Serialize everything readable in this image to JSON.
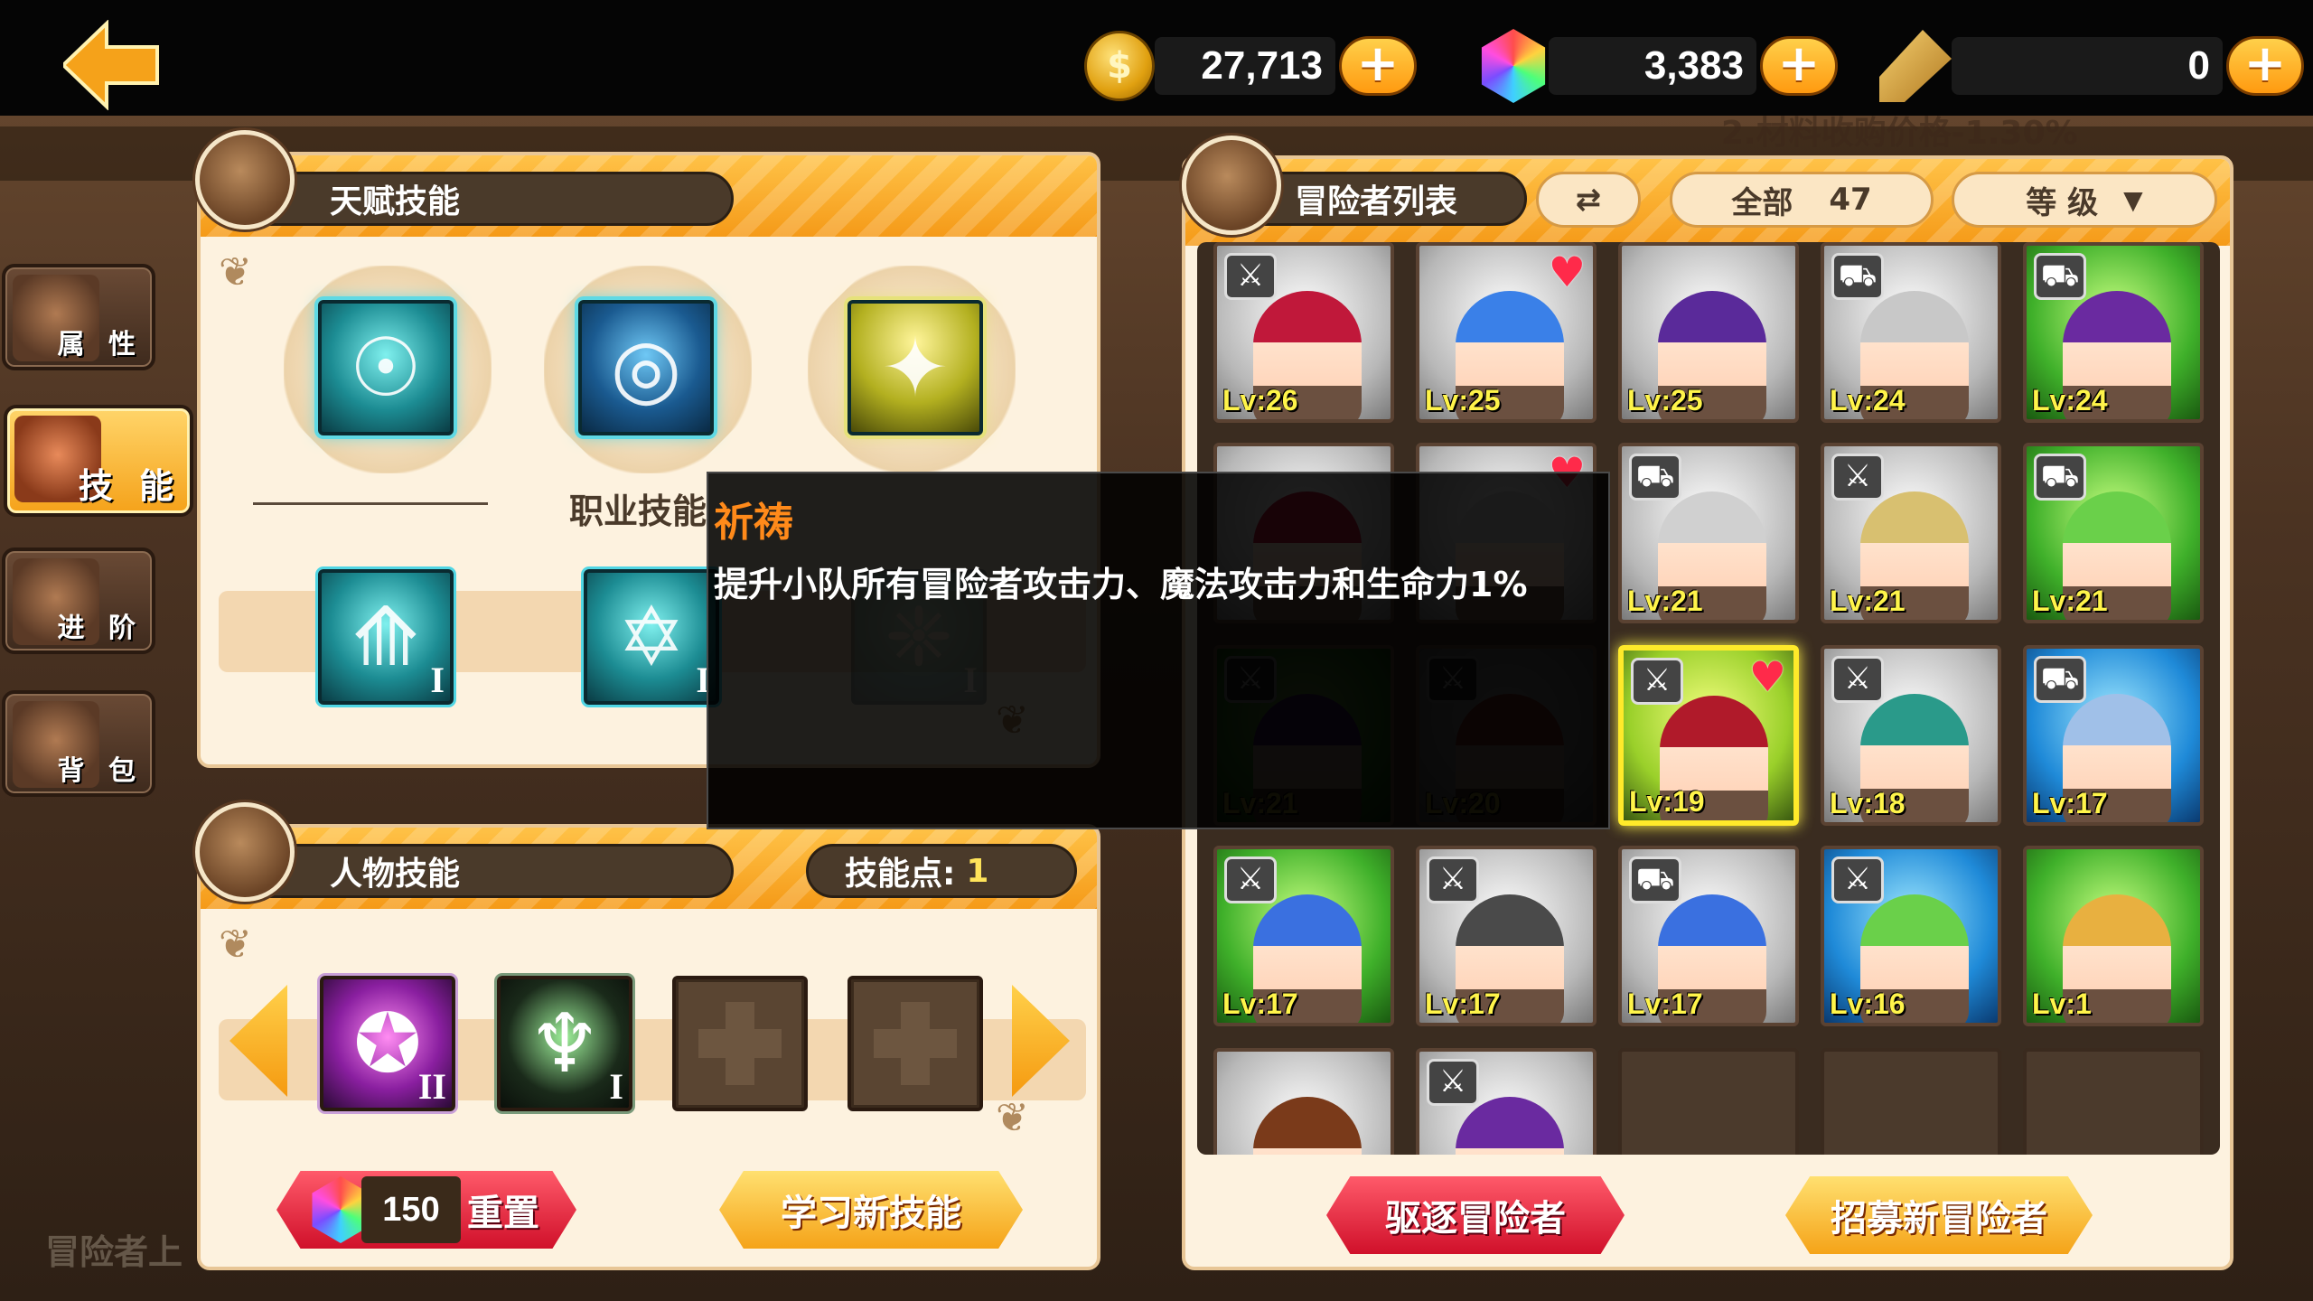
{
  "currencies": {
    "gold": "27,713",
    "gems": "3,383",
    "tickets": "0",
    "plus_label": "+"
  },
  "left_tabs": [
    {
      "label": "属 性",
      "icon": "knight-helmet-icon"
    },
    {
      "label": "技 能",
      "icon": "spellbook-icon"
    },
    {
      "label": "进 阶",
      "icon": "shield-gem-icon"
    },
    {
      "label": "背 包",
      "icon": "backpack-icon"
    }
  ],
  "talent_panel": {
    "title": "天赋技能",
    "job_skill_label": "职业技能"
  },
  "talent_skills": [
    {
      "icon": "brain-icon",
      "color": "teal"
    },
    {
      "icon": "hypnosis-book-icon",
      "color": "blue"
    },
    {
      "icon": "starlight-icon",
      "color": "gold"
    }
  ],
  "job_skills": [
    {
      "icon": "arrow-triangle-icon",
      "level": "I"
    },
    {
      "icon": "hexagram-flame-icon",
      "level": "I"
    },
    {
      "icon": "faded-skill-icon",
      "level": "I"
    }
  ],
  "character_panel": {
    "title": "人物技能",
    "skill_points_label": "技能点:",
    "skill_points": "1"
  },
  "character_skills": [
    {
      "icon": "dark-compass-icon",
      "level": "II",
      "type": "purple"
    },
    {
      "icon": "prayer-icon",
      "level": "I",
      "type": "dark"
    },
    {
      "icon": "add-slot-icon",
      "level": "",
      "type": "empty"
    },
    {
      "icon": "add-slot-icon",
      "level": "",
      "type": "empty"
    }
  ],
  "bottom_actions": {
    "reset_cost": "150",
    "reset_label": "重置",
    "learn_label": "学习新技能"
  },
  "adventurer_panel": {
    "title": "冒险者列表",
    "filter_label": "全部",
    "filter_count": "47",
    "sort_label": "等 级",
    "dismiss_label": "驱逐冒险者",
    "recruit_label": "招募新冒险者"
  },
  "adventurers": [
    {
      "lv": "Lv:26",
      "bg": "gray",
      "tag": "sword",
      "heart": false,
      "dim": false,
      "hair": "#c0183a"
    },
    {
      "lv": "Lv:25",
      "bg": "gray",
      "tag": "",
      "heart": true,
      "dim": false,
      "hair": "#3a80e8"
    },
    {
      "lv": "Lv:25",
      "bg": "gray",
      "tag": "",
      "heart": false,
      "dim": false,
      "hair": "#5a2a9a"
    },
    {
      "lv": "Lv:24",
      "bg": "gray",
      "tag": "bed",
      "heart": false,
      "dim": false,
      "hair": "#c8c8c8"
    },
    {
      "lv": "Lv:24",
      "bg": "green",
      "tag": "bed",
      "heart": false,
      "dim": false,
      "hair": "#6a2aa0"
    },
    {
      "lv": "",
      "bg": "gray",
      "tag": "",
      "heart": false,
      "dim": false,
      "hair": "#c0183a"
    },
    {
      "lv": "",
      "bg": "gray",
      "tag": "",
      "heart": true,
      "dim": false,
      "hair": "#d0d0d0"
    },
    {
      "lv": "Lv:21",
      "bg": "gray",
      "tag": "bed",
      "heart": false,
      "dim": false,
      "hair": "#d0d0d0"
    },
    {
      "lv": "Lv:21",
      "bg": "gray",
      "tag": "sword",
      "heart": false,
      "dim": false,
      "hair": "#d8c070"
    },
    {
      "lv": "Lv:21",
      "bg": "green",
      "tag": "bed",
      "heart": false,
      "dim": false,
      "hair": "#6ad04a"
    },
    {
      "lv": "Lv:21",
      "bg": "green",
      "tag": "sword",
      "heart": false,
      "dim": true,
      "hair": "#5a2a9a"
    },
    {
      "lv": "Lv:20",
      "bg": "gray",
      "tag": "sword",
      "heart": false,
      "dim": true,
      "hair": "#d04a3a"
    },
    {
      "lv": "Lv:19",
      "bg": "greenSel",
      "tag": "sword",
      "heart": true,
      "dim": false,
      "hair": "#b01a2a",
      "selected": true
    },
    {
      "lv": "Lv:18",
      "bg": "gray",
      "tag": "sword",
      "heart": false,
      "dim": false,
      "hair": "#2a9a8a"
    },
    {
      "lv": "Lv:17",
      "bg": "blue",
      "tag": "bed",
      "heart": false,
      "dim": false,
      "hair": "#a0c0e8"
    },
    {
      "lv": "Lv:17",
      "bg": "green",
      "tag": "sword",
      "heart": false,
      "dim": false,
      "hair": "#3a70e0"
    },
    {
      "lv": "Lv:17",
      "bg": "gray",
      "tag": "sword",
      "heart": false,
      "dim": false,
      "hair": "#4a4a4a"
    },
    {
      "lv": "Lv:17",
      "bg": "gray",
      "tag": "bed",
      "heart": false,
      "dim": false,
      "hair": "#3a70e0"
    },
    {
      "lv": "Lv:16",
      "bg": "blue",
      "tag": "sword",
      "heart": false,
      "dim": false,
      "hair": "#6ad04a"
    },
    {
      "lv": "Lv:1",
      "bg": "green",
      "tag": "",
      "heart": false,
      "dim": false,
      "hair": "#e8b040"
    },
    {
      "lv": "",
      "bg": "gray",
      "tag": "",
      "heart": false,
      "dim": false,
      "hair": "#7a3a1a"
    },
    {
      "lv": "",
      "bg": "gray",
      "tag": "sword",
      "heart": false,
      "dim": false,
      "hair": "#6a2aa0"
    },
    {
      "lv": "",
      "bg": "empty",
      "tag": "",
      "heart": false,
      "dim": false,
      "hair": ""
    },
    {
      "lv": "",
      "bg": "empty",
      "tag": "",
      "heart": false,
      "dim": false,
      "hair": ""
    },
    {
      "lv": "",
      "bg": "empty",
      "tag": "",
      "heart": false,
      "dim": false,
      "hair": ""
    }
  ],
  "tooltip": {
    "title": "祈祷",
    "description": "提升小队所有冒险者攻击力、魔法攻击力和生命力1%"
  },
  "background_text": {
    "bottom_left": "冒险者上",
    "notice_line": "2.材料收购价格-1.30%"
  }
}
